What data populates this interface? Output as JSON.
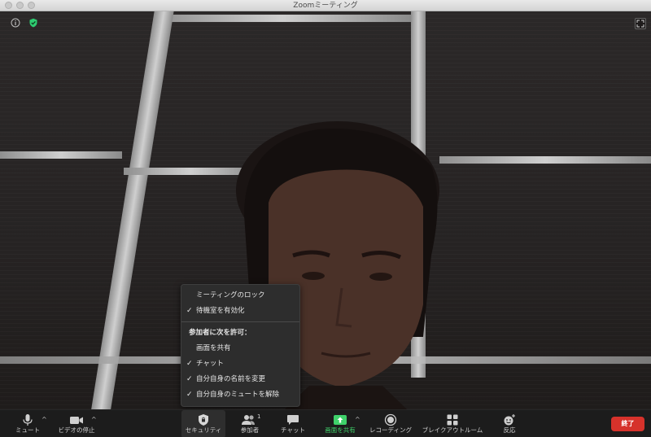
{
  "window": {
    "title": "Zoomミーティング"
  },
  "security_menu": {
    "items": [
      {
        "label": "ミーティングのロック",
        "checked": false
      },
      {
        "label": "待機室を有効化",
        "checked": true
      }
    ],
    "allow_header": "参加者に次を許可：",
    "allow_items": [
      {
        "label": "画面を共有",
        "checked": false
      },
      {
        "label": "チャット",
        "checked": true
      },
      {
        "label": "自分自身の名前を変更",
        "checked": true
      },
      {
        "label": "自分自身のミュートを解除",
        "checked": true
      }
    ],
    "check_glyph": "✓"
  },
  "toolbar": {
    "mute": "ミュート",
    "video": "ビデオの停止",
    "security": "セキュリティ",
    "participants": "参加者",
    "participants_count": "1",
    "chat": "チャット",
    "share": "画面を共有",
    "record": "レコーディング",
    "breakout": "ブレイクアウトルーム",
    "reactions": "反応",
    "end": "終了",
    "caret": "^"
  },
  "colors": {
    "share_accent": "#3fd16a",
    "end_button": "#d6322b",
    "shield_green": "#2ecc71"
  }
}
